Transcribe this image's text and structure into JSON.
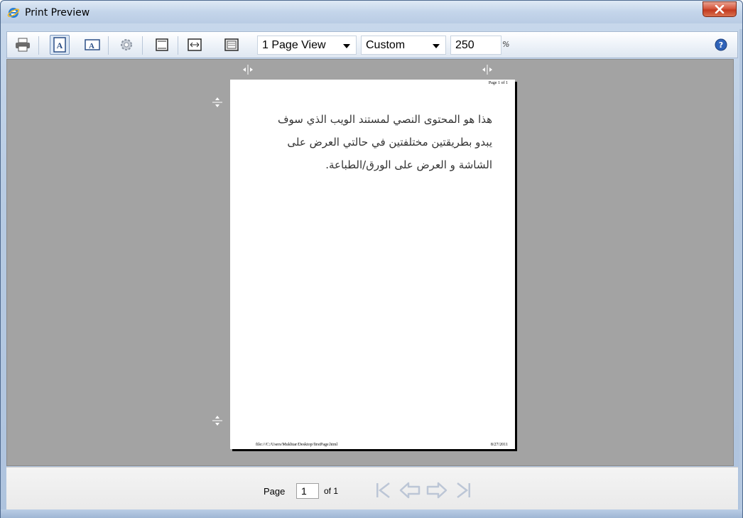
{
  "window": {
    "title": "Print Preview"
  },
  "toolbar": {
    "view_select": "1 Page View",
    "zoom_select": "Custom",
    "zoom_value": "250",
    "zoom_unit": "%"
  },
  "page": {
    "header": "Page 1 of 1",
    "body_lines": [
      "هذا هو المحتوى النصي لمستند الويب الذي سوف",
      "يبدو بطريقتين مختلفتين في حالتي العرض على",
      "الشاشة و العرض على الورق/الطباعة."
    ],
    "footer_left": "file:///C:/Users/Mukhtar/Desktop/firstPage.html",
    "footer_right": "8/27/2011"
  },
  "statusbar": {
    "page_label": "Page",
    "page_value": "1",
    "of_label": "of 1"
  },
  "colors": {
    "preview_bg": "#a3a3a3",
    "close_red": "#c33b20",
    "nav_disabled": "#bcc6d6"
  }
}
